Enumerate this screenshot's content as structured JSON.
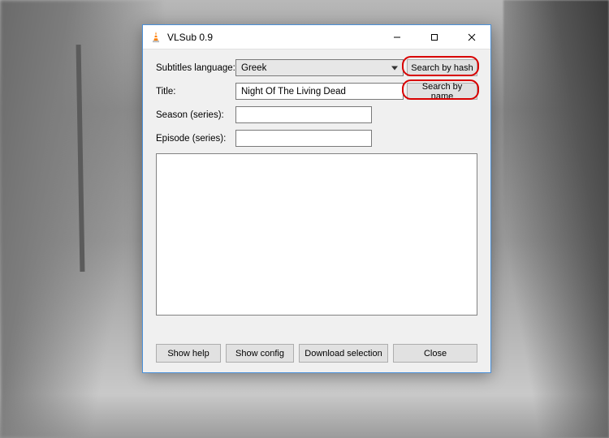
{
  "window": {
    "title": "VLSub 0.9"
  },
  "titlebar": {
    "minimize": "Minimize",
    "maximize": "Maximize",
    "close": "Close"
  },
  "form": {
    "language_label": "Subtitles language:",
    "language_value": "Greek",
    "title_label": "Title:",
    "title_value": "Night Of The Living Dead",
    "season_label": "Season (series):",
    "season_value": "",
    "episode_label": "Episode (series):",
    "episode_value": ""
  },
  "buttons": {
    "search_hash": "Search by hash",
    "search_name": "Search by name",
    "show_help": "Show help",
    "show_config": "Show config",
    "download": "Download selection",
    "close": "Close"
  }
}
